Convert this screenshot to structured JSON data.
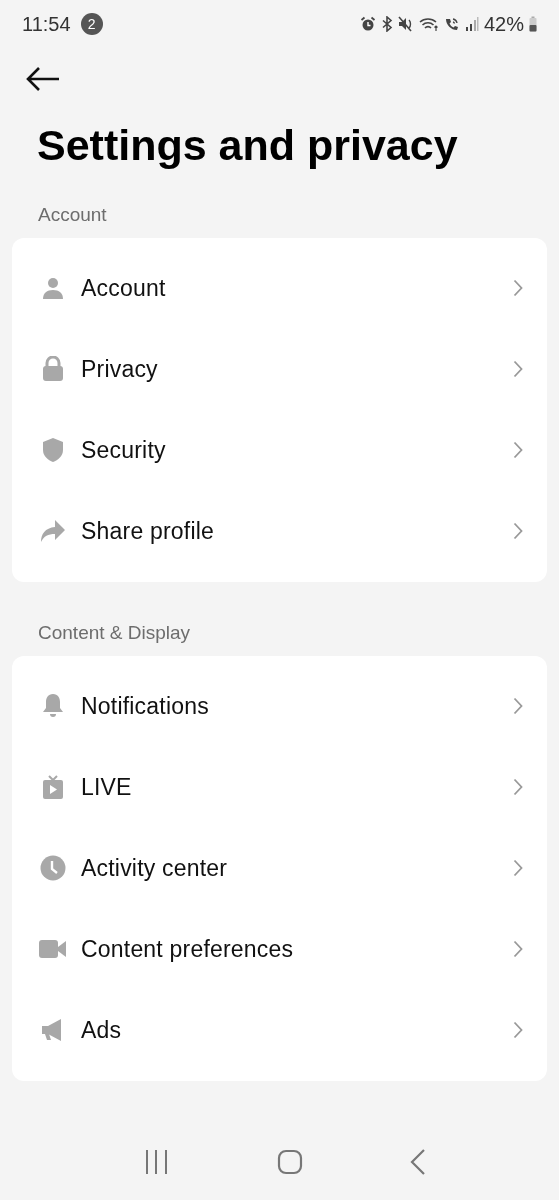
{
  "status_bar": {
    "time": "11:54",
    "notification_count": "2",
    "battery": "42%"
  },
  "title": "Settings and privacy",
  "sections": [
    {
      "label": "Account",
      "items": [
        {
          "kind": "person",
          "label": "Account"
        },
        {
          "kind": "lock",
          "label": "Privacy"
        },
        {
          "kind": "shield",
          "label": "Security"
        },
        {
          "kind": "share",
          "label": "Share profile"
        }
      ]
    },
    {
      "label": "Content & Display",
      "items": [
        {
          "kind": "bell",
          "label": "Notifications"
        },
        {
          "kind": "tv",
          "label": "LIVE"
        },
        {
          "kind": "clock",
          "label": "Activity center"
        },
        {
          "kind": "camera",
          "label": "Content preferences"
        },
        {
          "kind": "megaphone",
          "label": "Ads"
        }
      ]
    }
  ]
}
